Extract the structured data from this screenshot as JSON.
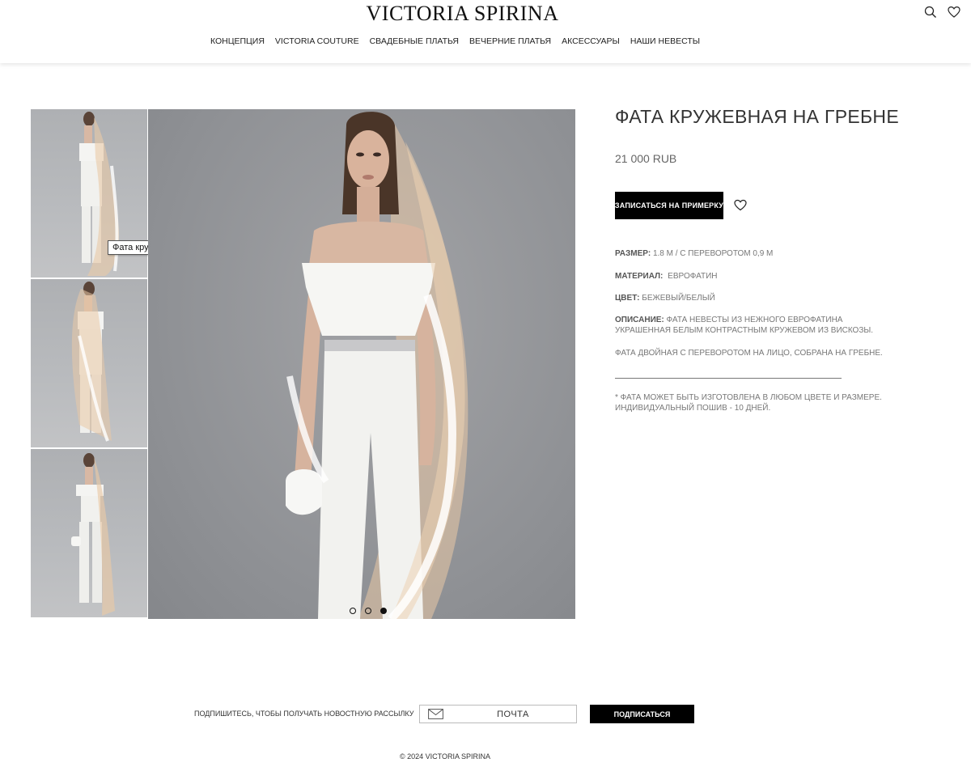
{
  "header": {
    "logo": "VICTORIA SPIRINA",
    "nav": [
      "КОНЦЕПЦИЯ",
      "VICTORIA COUTURE",
      "СВАДЕБНЫЕ ПЛАТЬЯ",
      "ВЕЧЕРНИЕ ПЛАТЬЯ",
      "АКСЕССУАРЫ",
      "НАШИ НЕВЕСТЫ"
    ],
    "icons": [
      "search-icon",
      "heart-icon"
    ]
  },
  "gallery": {
    "tooltip": "Фата кружевная на гребне",
    "thumbnail_count": 3,
    "slide_count": 3,
    "active_slide": 3
  },
  "product": {
    "title": "ФАТА КРУЖЕВНАЯ НА ГРЕБНЕ",
    "price": "21 000 RUB",
    "book_button": "ЗАПИСАТЬСЯ НА ПРИМЕРКУ",
    "size_label": "РАЗМЕР:",
    "size_value": "1.8 М / С ПЕРЕВОРОТОМ 0,9 М",
    "material_label": "МАТЕРИАЛ:",
    "material_value": "ЕВРОФАТИН",
    "color_label": "ЦВЕТ:",
    "color_value": "БЕЖЕВЫЙ/БЕЛЫЙ",
    "description_label": "ОПИСАНИЕ:",
    "description_value": "ФАТА НЕВЕСТЫ ИЗ НЕЖНОГО ЕВРОФАТИНА УКРАШЕННАЯ БЕЛЫМ КОНТРАСТНЫМ КРУЖЕВОМ ИЗ ВИСКОЗЫ.",
    "description_extra": "ФАТА ДВОЙНАЯ С ПЕРЕВОРОТОМ НА ЛИЦО, СОБРАНА НА ГРЕБНЕ.",
    "note": "* ФАТА МОЖЕТ БЫТЬ ИЗГОТОВЛЕНА В ЛЮБОМ ЦВЕТЕ И РАЗМЕРЕ. ИНДИВИДУАЛЬНЫЙ ПОШИВ - 10 ДНЕЙ."
  },
  "footer": {
    "subscribe_text": "ПОДПИШИТЕСЬ, ЧТОБЫ ПОЛУЧАТЬ НОВОСТНУЮ РАССЫЛКУ",
    "email_placeholder": "ПОЧТА",
    "subscribe_button": "ПОДПИСАТЬСЯ",
    "copyright": "© 2024 VICTORIA SPIRINA"
  },
  "colors": {
    "accent": "#000000",
    "photo_background": "#8e9094",
    "veil": "#e9c9a6"
  }
}
